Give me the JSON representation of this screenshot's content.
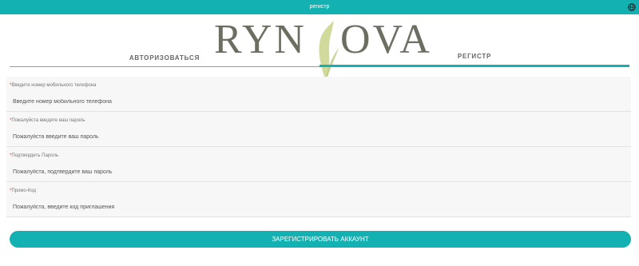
{
  "header": {
    "title": "регистр",
    "language_icon": "globe-icon"
  },
  "logo": {
    "left_text": "RYN",
    "right_text": "OVA"
  },
  "tabs": [
    {
      "label": "АВТОРИЗОВАТЬСЯ",
      "active": false
    },
    {
      "label": "РЕГИСТР",
      "active": true
    }
  ],
  "form": {
    "fields": [
      {
        "required_mark": "*",
        "label": "Введите номер мобильного телефона",
        "placeholder": "Введите номер мобильного телефона",
        "value": ""
      },
      {
        "required_mark": "*",
        "label": "Пожалуйста введите ваш пароль",
        "placeholder": "Пожалуйста введите ваш пароль",
        "value": ""
      },
      {
        "required_mark": "*",
        "label": "Подтвердить Пароль",
        "placeholder": "Пожалуйста, подтвердите ваш пароль",
        "value": ""
      },
      {
        "required_mark": "*",
        "label": "Промо-Код",
        "placeholder": "Пожалуйста, введите код приглашения",
        "value": ""
      }
    ],
    "submit_label": "ЗАРЕГИСТРИРОВАТЬ АККАУНТ"
  },
  "colors": {
    "accent": "#13b1b1",
    "required": "#e53935",
    "logo": "#6d6d62",
    "leaf": "#b8c47a"
  }
}
